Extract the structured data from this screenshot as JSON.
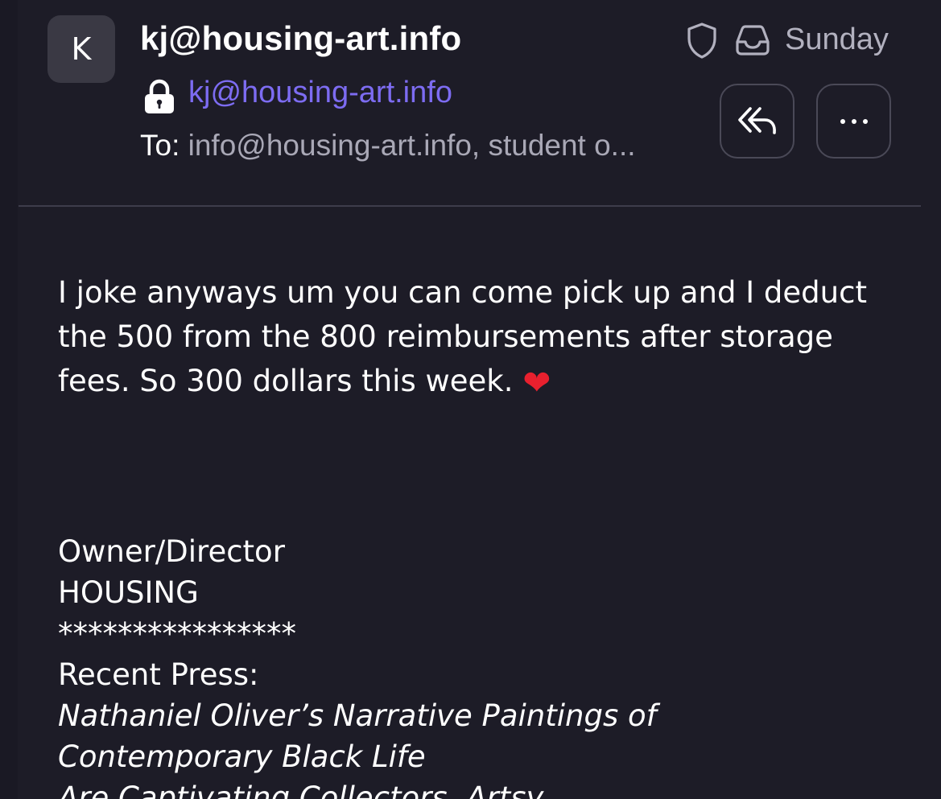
{
  "header": {
    "avatar_initial": "K",
    "sender_name": "kj@housing-art.info",
    "sender_email": "kj@housing-art.info",
    "to_label": "To:",
    "to_value": " info@housing-art.info, student o...",
    "date": "Sunday"
  },
  "icons": {
    "lock": "lock-icon",
    "shield": "shield-icon",
    "inbox": "inbox-icon",
    "reply_all": "reply-all-icon",
    "more": "more-icon"
  },
  "colors": {
    "background": "#1d1c27",
    "accent": "#7d6cf2",
    "heart": "#e8202e"
  },
  "message": {
    "body": "I joke anyways um you can come pick up and I deduct the 500 from the 800 reimbursements after storage fees. So 300 dollars this week.",
    "emoji": "❤"
  },
  "signature": {
    "title": "Owner/Director",
    "company": "HOUSING",
    "separator": "****************",
    "press_label": "Recent Press:",
    "press_line_1": "Nathaniel Oliver’s Narrative Paintings of",
    "press_line_2": "Contemporary Black Life",
    "press_line_3": "Are Captivating Collectors, Artsy"
  }
}
